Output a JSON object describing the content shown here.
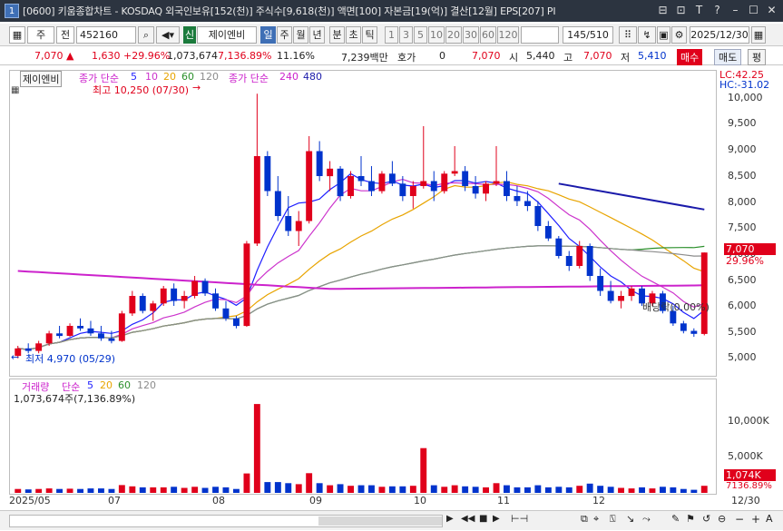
{
  "window": {
    "number": "1",
    "title": "[0600] 키움종합차트 - KOSDAQ 외국인보유[152(천)] 주식수[9,618(천)] 액면[100] 자본금[19(억)] 결산[12월] EPS[207] PI",
    "controls": [
      "⊟",
      "⊡",
      "T",
      "?",
      "–",
      "☐",
      "✕"
    ]
  },
  "toolbar": {
    "period_type": "주",
    "market_label": "전",
    "code": "452160",
    "stock_name": "제이엔비",
    "stock_badge": "신",
    "periods": [
      "일",
      "주",
      "월",
      "년",
      "분",
      "초",
      "틱"
    ],
    "intervals": [
      "1",
      "3",
      "5",
      "10",
      "20",
      "30",
      "60",
      "120"
    ],
    "count": "145",
    "count_total": "/510",
    "date": "2025/12/30"
  },
  "infobar": {
    "price": "7,070",
    "change": "1,630",
    "change_pct": "+29.96%",
    "volume": "1,073,674",
    "volume_ratio": "7,136.89%",
    "turnover": "11.16%",
    "amount": "7,239백만",
    "quote_label": "호가",
    "quote_value": "0",
    "quote_price": "7,070",
    "open_label": "시",
    "open": "5,440",
    "high_label": "고",
    "high": "7,070",
    "low_label": "저",
    "low": "5,410",
    "buy_label": "매수",
    "sell_label": "매도",
    "eval_label": "평"
  },
  "main_pane": {
    "stock_label": "제이엔비",
    "legend_ma_prefix": "종가 단순",
    "legend_ma_values": [
      "5",
      "10",
      "20",
      "60",
      "120"
    ],
    "legend_ma2_prefix": "종가 단순",
    "legend_ma2_values": [
      "240",
      "480"
    ],
    "high_note": "최고 10,250 (07/30)",
    "low_note": "최저 4,970 (05/29)",
    "dividend_note": "배당락(0.00%)",
    "lc": "LC:42.25",
    "hc": "HC:-31.02",
    "price_axis": [
      "10,000",
      "9,500",
      "9,000",
      "8,500",
      "8,000",
      "7,500",
      "7,000",
      "6,500",
      "6,000",
      "5,500",
      "5,000"
    ],
    "last_price_tag": "7,070",
    "last_pct_tag": "29.96%"
  },
  "volume_pane": {
    "legend_name": "거래량",
    "legend_ma_prefix": "단순",
    "legend_ma_values": [
      "5",
      "20",
      "60",
      "120"
    ],
    "volume_text": "1,073,674주(7,136.89%)",
    "axis": [
      "10,000K",
      "5,000K"
    ],
    "last_tag": "1,074K",
    "last_pct_tag": "7136.89%"
  },
  "date_axis": [
    "2025/05",
    "07",
    "08",
    "09",
    "10",
    "11",
    "12",
    "12/30"
  ],
  "colors": {
    "up": "#e0001b",
    "down": "#0033cc",
    "ma5": "#1f1fff",
    "ma10": "#cc33cc",
    "ma20": "#e8a400",
    "ma60": "#2a8f2a",
    "ma120": "#8c8c8c",
    "ma240": "#cc22cc",
    "ma480": "#1a1aaa"
  },
  "chart_data": {
    "type": "candlestick",
    "ylim": [
      4800,
      10400
    ],
    "candles": [
      [
        5000,
        5200,
        4950,
        5150
      ],
      [
        5150,
        5250,
        5050,
        5100
      ],
      [
        5100,
        5300,
        5050,
        5250
      ],
      [
        5250,
        5500,
        5200,
        5450
      ],
      [
        5450,
        5600,
        5350,
        5400
      ],
      [
        5400,
        5650,
        5380,
        5600
      ],
      [
        5600,
        5750,
        5500,
        5550
      ],
      [
        5550,
        5700,
        5400,
        5450
      ],
      [
        5450,
        5600,
        5300,
        5350
      ],
      [
        5350,
        5500,
        5250,
        5300
      ],
      [
        5300,
        5900,
        5280,
        5850
      ],
      [
        5850,
        6300,
        5800,
        6200
      ],
      [
        6200,
        6250,
        5850,
        5900
      ],
      [
        5900,
        6100,
        5700,
        6050
      ],
      [
        6050,
        6400,
        6000,
        6350
      ],
      [
        6350,
        6450,
        6000,
        6100
      ],
      [
        6100,
        6300,
        5950,
        6200
      ],
      [
        6200,
        6600,
        6150,
        6500
      ],
      [
        6500,
        6550,
        6200,
        6250
      ],
      [
        6250,
        6350,
        5900,
        5950
      ],
      [
        5950,
        6100,
        5700,
        5750
      ],
      [
        5750,
        5800,
        5550,
        5600
      ],
      [
        5600,
        7300,
        5580,
        7250
      ],
      [
        7250,
        10250,
        7200,
        9000
      ],
      [
        9000,
        9100,
        8200,
        8300
      ],
      [
        8300,
        8600,
        7700,
        7800
      ],
      [
        7800,
        8200,
        7400,
        7500
      ],
      [
        7500,
        7900,
        7200,
        7700
      ],
      [
        7700,
        9400,
        7650,
        9100
      ],
      [
        9100,
        9300,
        8500,
        8600
      ],
      [
        8600,
        8900,
        8300,
        8750
      ],
      [
        8750,
        8800,
        8100,
        8200
      ],
      [
        8200,
        8700,
        8150,
        8600
      ],
      [
        8600,
        9000,
        8400,
        8500
      ],
      [
        8500,
        8800,
        8200,
        8300
      ],
      [
        8300,
        8700,
        8250,
        8650
      ],
      [
        8650,
        8900,
        8400,
        8450
      ],
      [
        8450,
        8600,
        8100,
        8200
      ],
      [
        8200,
        8500,
        7950,
        8400
      ],
      [
        8400,
        9600,
        8350,
        8500
      ],
      [
        8500,
        8700,
        8100,
        8300
      ],
      [
        8300,
        8700,
        8250,
        8650
      ],
      [
        8650,
        9200,
        8600,
        8700
      ],
      [
        8700,
        8800,
        8300,
        8400
      ],
      [
        8400,
        8600,
        8150,
        8250
      ],
      [
        8250,
        8500,
        8100,
        8450
      ],
      [
        8450,
        9200,
        8400,
        8500
      ],
      [
        8500,
        8700,
        8100,
        8200
      ],
      [
        8200,
        8400,
        8000,
        8100
      ],
      [
        8100,
        8300,
        7900,
        8000
      ],
      [
        8000,
        8100,
        7500,
        7600
      ],
      [
        7600,
        7700,
        7300,
        7350
      ],
      [
        7350,
        7400,
        6950,
        7000
      ],
      [
        7000,
        7100,
        6700,
        6800
      ],
      [
        6800,
        7300,
        6750,
        7200
      ],
      [
        7200,
        7250,
        6500,
        6600
      ],
      [
        6600,
        6750,
        6200,
        6300
      ],
      [
        6300,
        6500,
        6050,
        6100
      ],
      [
        6100,
        6300,
        5950,
        6200
      ],
      [
        6200,
        6400,
        6100,
        6350
      ],
      [
        6350,
        6400,
        6000,
        6050
      ],
      [
        6050,
        6300,
        6000,
        6250
      ],
      [
        6250,
        6300,
        5850,
        5900
      ],
      [
        5900,
        6000,
        5600,
        5650
      ],
      [
        5650,
        5700,
        5450,
        5500
      ],
      [
        5500,
        5550,
        5380,
        5440
      ],
      [
        5440,
        7070,
        5410,
        7070
      ]
    ]
  }
}
